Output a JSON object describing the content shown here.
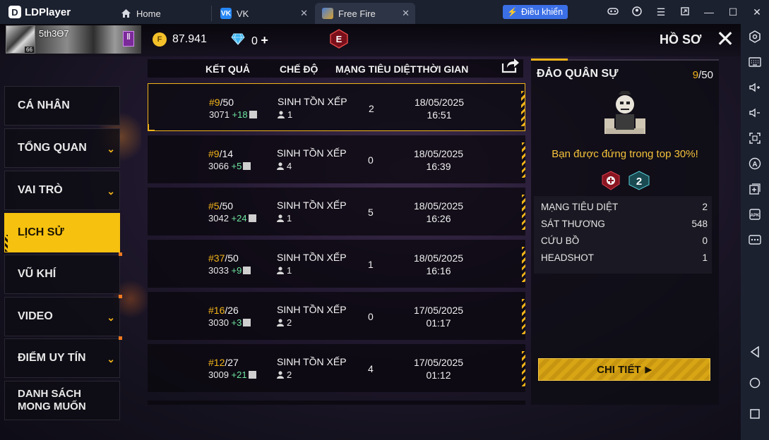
{
  "emulator": {
    "brand": "LDPlayer",
    "tabs": [
      {
        "label": "Home",
        "icon": "house-icon"
      },
      {
        "label": "VK",
        "icon": "vk-logo-icon"
      },
      {
        "label": "Free Fire",
        "icon": "free-fire-app-icon"
      }
    ],
    "control_button": "Điều khiển",
    "window_icons": [
      "gamepad-icon",
      "account-icon",
      "menu-icon",
      "restore-window-icon",
      "minimize-icon",
      "maximize-icon",
      "close-icon"
    ],
    "sidebar_icons": [
      "settings-icon",
      "keyboard-icon",
      "volume-up-icon",
      "volume-down-icon",
      "screenshot-icon",
      "auto-icon",
      "add-window-icon",
      "apk-icon",
      "more-icon",
      "back-icon",
      "home-icon",
      "recents-icon"
    ]
  },
  "header": {
    "player_name": "5th3Ɵ7",
    "avatar_level": "66",
    "coins": "87.941",
    "diamonds": "0",
    "rank_badge": "E",
    "title": "HỒ SƠ"
  },
  "menu": [
    {
      "label": "CÁ NHÂN",
      "chevron": false,
      "active": false,
      "dot": false
    },
    {
      "label": "TỔNG QUAN",
      "chevron": true,
      "active": false,
      "dot": false
    },
    {
      "label": "VAI TRÒ",
      "chevron": true,
      "active": false,
      "dot": false
    },
    {
      "label": "LỊCH SỬ",
      "chevron": false,
      "active": true,
      "dot": false
    },
    {
      "label": "VŨ KHÍ",
      "chevron": false,
      "active": false,
      "dot": true
    },
    {
      "label": "VIDEO",
      "chevron": true,
      "active": false,
      "dot": true
    },
    {
      "label": "ĐIỂM UY TÍN",
      "chevron": true,
      "active": false,
      "dot": true
    },
    {
      "label": "DANH SÁCH MONG MUỐN",
      "chevron": false,
      "active": false,
      "dot": false
    }
  ],
  "history": {
    "columns": [
      "KẾT QUẢ",
      "CHẾ ĐỘ",
      "MẠNG TIÊU DIỆT",
      "THỜI GIAN"
    ],
    "rows": [
      {
        "rank": "#9",
        "total": "/50",
        "points": "3071",
        "delta": "+18",
        "mode": "SINH TỒN XẾP HẠNG",
        "team": "1",
        "kills": "2",
        "date": "18/05/2025",
        "time": "16:51"
      },
      {
        "rank": "#9",
        "total": "/14",
        "points": "3066",
        "delta": "+5",
        "mode": "SINH TỒN XẾP HẠNG",
        "team": "4",
        "kills": "0",
        "date": "18/05/2025",
        "time": "16:39"
      },
      {
        "rank": "#5",
        "total": "/50",
        "points": "3042",
        "delta": "+24",
        "mode": "SINH TỒN XẾP HẠNG",
        "team": "1",
        "kills": "5",
        "date": "18/05/2025",
        "time": "16:26"
      },
      {
        "rank": "#37",
        "total": "/50",
        "points": "3033",
        "delta": "+9",
        "mode": "SINH TỒN XẾP HẠNG",
        "team": "1",
        "kills": "1",
        "date": "18/05/2025",
        "time": "16:16"
      },
      {
        "rank": "#16",
        "total": "/26",
        "points": "3030",
        "delta": "+3",
        "mode": "SINH TỒN XẾP HẠNG",
        "team": "2",
        "kills": "0",
        "date": "17/05/2025",
        "time": "01:17"
      },
      {
        "rank": "#12",
        "total": "/27",
        "points": "3009",
        "delta": "+21",
        "mode": "SINH TỒN XẾP HẠNG",
        "team": "2",
        "kills": "4",
        "date": "17/05/2025",
        "time": "01:12"
      }
    ]
  },
  "detail": {
    "map_name": "ĐẢO QUÂN SỰ",
    "rank": "9",
    "total": "/50",
    "message": "Bạn được đứng trong top 30%!",
    "stats": [
      {
        "label": "MẠNG TIÊU DIỆT",
        "value": "2"
      },
      {
        "label": "SÁT THƯƠNG",
        "value": "548"
      },
      {
        "label": "CỨU BỒ",
        "value": "0"
      },
      {
        "label": "HEADSHOT",
        "value": "1"
      }
    ],
    "button": "CHI TIẾT"
  },
  "colors": {
    "accent": "#f2b318",
    "active_menu": "#f6c10f",
    "positive": "#6ee6a0",
    "message": "#f4c13a"
  }
}
